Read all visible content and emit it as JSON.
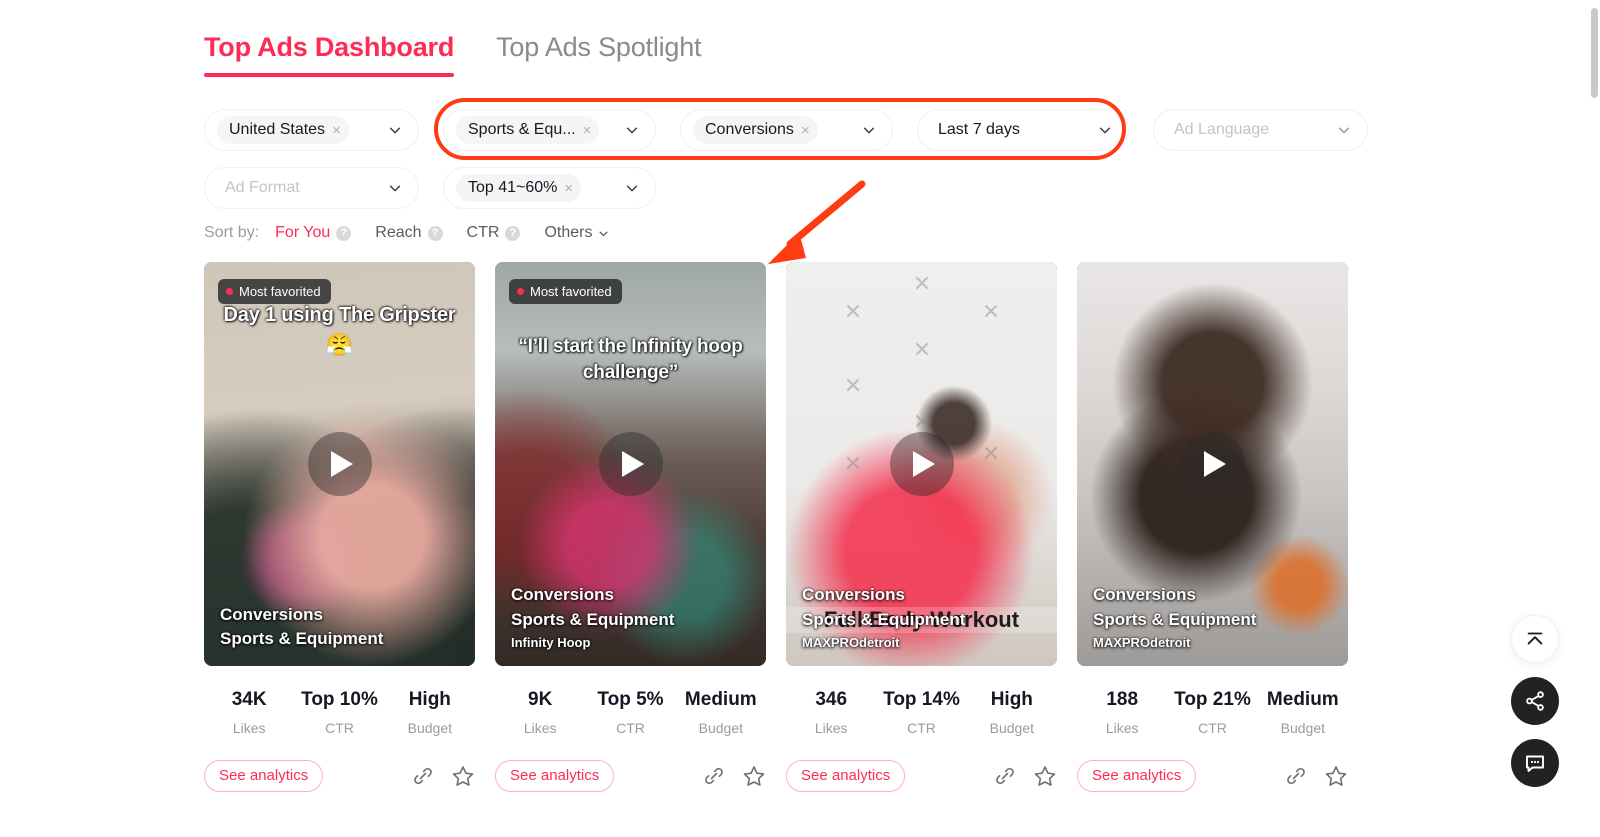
{
  "tabs": [
    {
      "label": "Top Ads Dashboard",
      "active": true
    },
    {
      "label": "Top Ads Spotlight",
      "active": false
    }
  ],
  "filters": {
    "row1": [
      {
        "name": "region",
        "type": "pill",
        "value": "United States",
        "highlighted": false
      },
      {
        "name": "industry",
        "type": "pill",
        "value": "Sports & Equ...",
        "highlighted": true
      },
      {
        "name": "objective",
        "type": "pill",
        "value": "Conversions",
        "highlighted": true
      },
      {
        "name": "date-range",
        "type": "plain",
        "value": "Last 7 days",
        "highlighted": true
      },
      {
        "name": "ad-language",
        "type": "placeholder",
        "value": "Ad Language",
        "highlighted": false
      }
    ],
    "row2": [
      {
        "name": "ad-format",
        "type": "placeholder",
        "value": "Ad Format",
        "highlighted": false
      },
      {
        "name": "likes-range",
        "type": "pill",
        "value": "Top 41~60%",
        "highlighted": false
      }
    ],
    "highlight_color": "#ff3b14",
    "remove_glyph": "×"
  },
  "sort": {
    "label": "Sort by:",
    "options": [
      {
        "label": "For You",
        "active": true,
        "help": true
      },
      {
        "label": "Reach",
        "active": false,
        "help": true
      },
      {
        "label": "CTR",
        "active": false,
        "help": true
      },
      {
        "label": "Others",
        "active": false,
        "help": false,
        "chevron": true
      }
    ],
    "help_glyph": "?"
  },
  "annotation": {
    "arrow_color": "#ff3b14",
    "box_color": "#ff3b14"
  },
  "stat_keys": {
    "likes": "Likes",
    "ctr": "CTR",
    "budget": "Budget"
  },
  "card_actions": {
    "see_analytics": "See analytics",
    "link_icon": "link-icon",
    "star_icon": "star-icon"
  },
  "cards": [
    {
      "badge": "Most favorited",
      "has_badge": true,
      "video_caption": "Day 1 using The Gripster",
      "video_emoji": "😤",
      "video_label": "",
      "objective": "Conversions",
      "industry": "Sports & Equipment",
      "brand": "",
      "likes": "34K",
      "ctr": "Top 10%",
      "budget": "High"
    },
    {
      "badge": "Most favorited",
      "has_badge": true,
      "video_caption": "“I’ll start the Infinity hoop challenge”",
      "video_emoji": "",
      "video_label": "",
      "objective": "Conversions",
      "industry": "Sports & Equipment",
      "brand": "Infinity Hoop",
      "likes": "9K",
      "ctr": "Top 5%",
      "budget": "Medium"
    },
    {
      "badge": "",
      "has_badge": false,
      "video_caption": "",
      "video_emoji": "",
      "video_label": "Full Body Workout",
      "objective": "Conversions",
      "industry": "Sports & Equipment",
      "brand": "MAXPROdetroit",
      "likes": "346",
      "ctr": "Top 14%",
      "budget": "High"
    },
    {
      "badge": "",
      "has_badge": false,
      "video_caption": "",
      "video_emoji": "",
      "video_label": "",
      "objective": "Conversions",
      "industry": "Sports & Equipment",
      "brand": "MAXPROdetroit",
      "likes": "188",
      "ctr": "Top 21%",
      "budget": "Medium"
    }
  ],
  "fabs": [
    {
      "name": "scroll-to-top-button",
      "icon": "arrow-up-to-line-icon",
      "style": "light"
    },
    {
      "name": "share-button",
      "icon": "share-icon",
      "style": "dark"
    },
    {
      "name": "feedback-button",
      "icon": "chat-bubble-icon",
      "style": "dark"
    }
  ]
}
